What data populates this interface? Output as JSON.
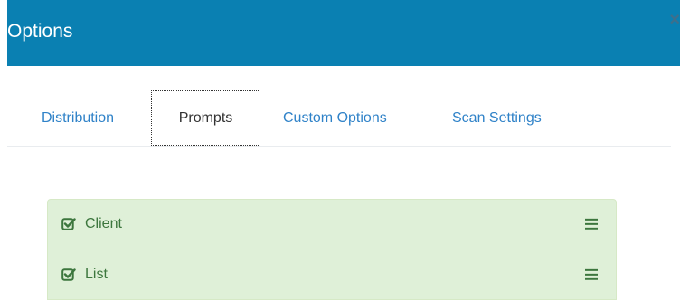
{
  "dialog": {
    "title": "Options",
    "close_label": "×"
  },
  "tabs": [
    {
      "label": "Distribution",
      "active": false
    },
    {
      "label": "Prompts",
      "active": true
    },
    {
      "label": "Custom Options",
      "active": false
    },
    {
      "label": "Scan Settings",
      "active": false
    }
  ],
  "prompts": [
    {
      "label": "Client",
      "checked": true,
      "icon": "check-square-icon",
      "handle": "drag-handle-icon"
    },
    {
      "label": "List",
      "checked": true,
      "icon": "check-square-icon",
      "handle": "drag-handle-icon"
    }
  ],
  "colors": {
    "header_bg": "#0a80b2",
    "tab_link": "#2f82c8",
    "item_bg": "#dff0d8",
    "item_text": "#3c763d"
  }
}
